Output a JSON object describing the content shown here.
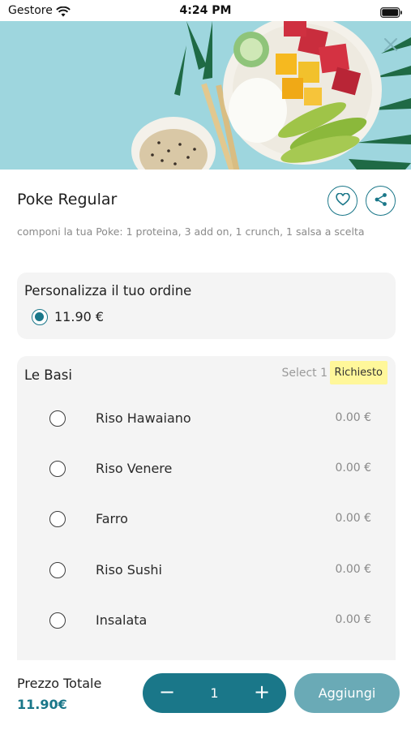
{
  "status_bar": {
    "carrier": "Gestore",
    "time": "4:24 PM"
  },
  "product": {
    "title": "Poke Regular",
    "description": "componi la tua Poke: 1 proteina, 3 add on, 1 crunch, 1 salsa a scelta"
  },
  "customize": {
    "title": "Personalizza il tuo ordine",
    "selected_price": "11.90 €"
  },
  "bases": {
    "title": "Le Basi",
    "select_hint": "Select 1",
    "required_badge": "Richiesto",
    "options": [
      {
        "name": "Riso Hawaiano",
        "price": "0.00 €"
      },
      {
        "name": "Riso Venere",
        "price": "0.00 €"
      },
      {
        "name": "Farro",
        "price": "0.00 €"
      },
      {
        "name": "Riso Sushi",
        "price": "0.00 €"
      },
      {
        "name": "Insalata",
        "price": "0.00 €"
      }
    ]
  },
  "footer": {
    "total_label": "Prezzo Totale",
    "total_value": "11.90€",
    "quantity": "1",
    "minus": "−",
    "plus": "+",
    "add_label": "Aggiungi"
  },
  "colors": {
    "accent": "#1a7789",
    "add_button": "#6aaab6",
    "required_badge": "#fff79a"
  },
  "icons": [
    "wifi-icon",
    "battery-icon",
    "close-icon",
    "heart-icon",
    "share-icon",
    "radio-icon"
  ]
}
